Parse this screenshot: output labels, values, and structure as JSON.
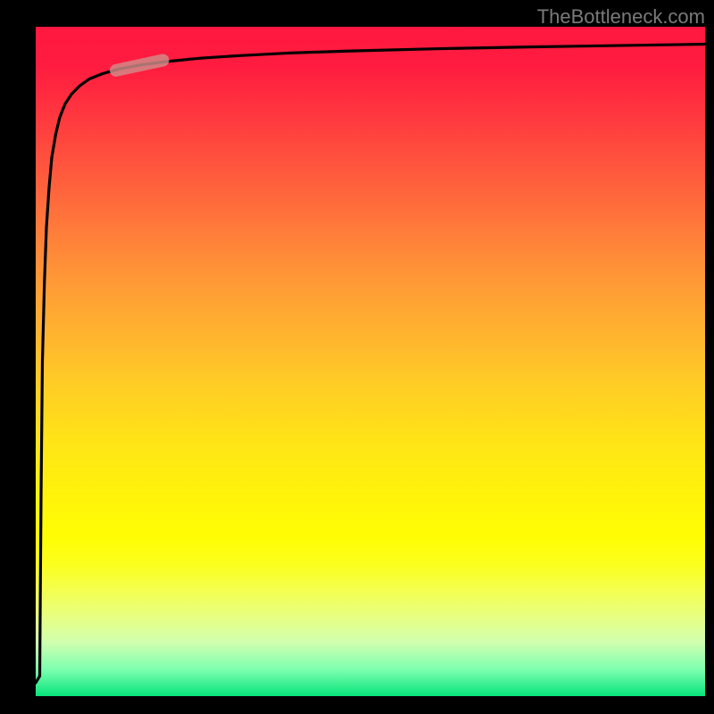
{
  "attribution": "TheBottleneck.com",
  "chart_data": {
    "type": "line",
    "title": "",
    "xlabel": "",
    "ylabel": "",
    "xlim": [
      0,
      100
    ],
    "ylim": [
      0,
      100
    ],
    "series": [
      {
        "name": "curve",
        "x": [
          0.0,
          0.6,
          0.8,
          1.0,
          1.3,
          1.6,
          2.0,
          2.4,
          3.0,
          3.6,
          4.4,
          5.4,
          6.6,
          8.0,
          10.0,
          12.5,
          15.6,
          19.5,
          24.4,
          30.5,
          38.1,
          47.7,
          59.6,
          74.5,
          93.1,
          100.0
        ],
        "y": [
          2.0,
          3.0,
          30.0,
          50.0,
          62.0,
          70.0,
          76.0,
          80.5,
          84.0,
          86.5,
          88.5,
          90.0,
          91.2,
          92.2,
          93.0,
          93.7,
          94.3,
          94.8,
          95.3,
          95.7,
          96.1,
          96.4,
          96.7,
          97.0,
          97.3,
          97.4
        ]
      }
    ],
    "highlight_segment": {
      "x_range": [
        12,
        19
      ],
      "y_range": [
        93.5,
        95.0
      ],
      "color": "#cf8c8a"
    },
    "background_gradient_stops": [
      {
        "pct": 0,
        "color": "#ff173f"
      },
      {
        "pct": 30,
        "color": "#ff7a3a"
      },
      {
        "pct": 60,
        "color": "#ffe416"
      },
      {
        "pct": 80,
        "color": "#fcff1a"
      },
      {
        "pct": 96,
        "color": "#7dffb0"
      },
      {
        "pct": 100,
        "color": "#07e47a"
      }
    ]
  }
}
